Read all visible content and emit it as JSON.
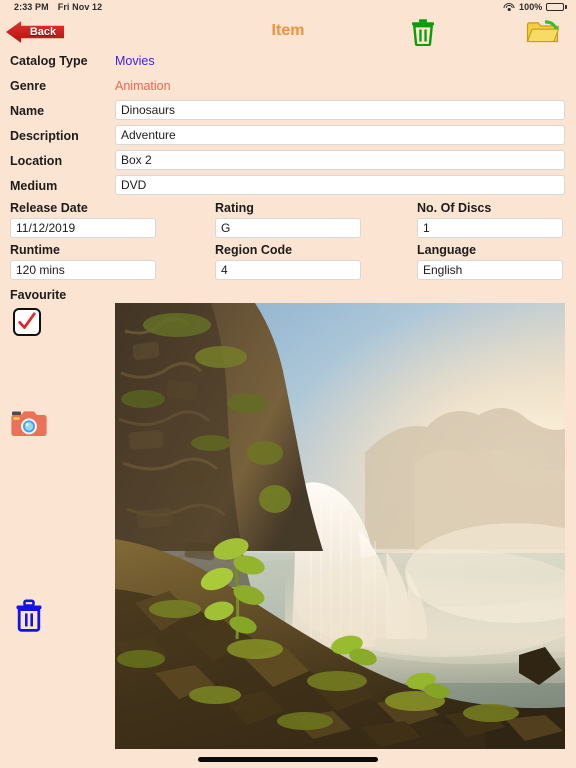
{
  "status_bar": {
    "time": "2:33 PM",
    "date": "Fri Nov 12",
    "battery_percent": "100%",
    "wifi_icon": "wifi-icon",
    "battery_icon": "battery-full-icon"
  },
  "nav": {
    "back_label": "Back",
    "title": "Item",
    "delete_icon": "trash-icon",
    "folder_icon": "folder-open-icon"
  },
  "form": {
    "catalog_type": {
      "label": "Catalog Type",
      "value": "Movies"
    },
    "genre": {
      "label": "Genre",
      "value": "Animation"
    },
    "name": {
      "label": "Name",
      "value": "Dinosaurs"
    },
    "description": {
      "label": "Description",
      "value": "Adventure"
    },
    "location": {
      "label": "Location",
      "value": "Box 2"
    },
    "medium": {
      "label": "Medium",
      "value": "DVD"
    },
    "release_date": {
      "label": "Release Date",
      "value": "11/12/2019"
    },
    "rating": {
      "label": "Rating",
      "value": "G"
    },
    "no_of_discs": {
      "label": "No. Of Discs",
      "value": "1"
    },
    "runtime": {
      "label": "Runtime",
      "value": "120 mins"
    },
    "region_code": {
      "label": "Region Code",
      "value": "4"
    },
    "language": {
      "label": "Language",
      "value": "English"
    },
    "favourite": {
      "label": "Favourite",
      "checked": true,
      "check_icon": "checkmark-icon"
    }
  },
  "side_actions": {
    "camera_icon": "camera-icon",
    "delete_photo_icon": "trash-icon"
  },
  "photo": {
    "alt": "waterfall over mossy basalt cliff at sunrise",
    "name": "item-photo"
  },
  "colors": {
    "background": "#fce4d2",
    "title": "#f2913d",
    "link": "#3b23e8",
    "genre": "#f4654f",
    "back_button": "#c91f1c",
    "nav_trash": "#0aa00a",
    "folder": "#efc game",
    "side_trash": "#1414e0"
  }
}
